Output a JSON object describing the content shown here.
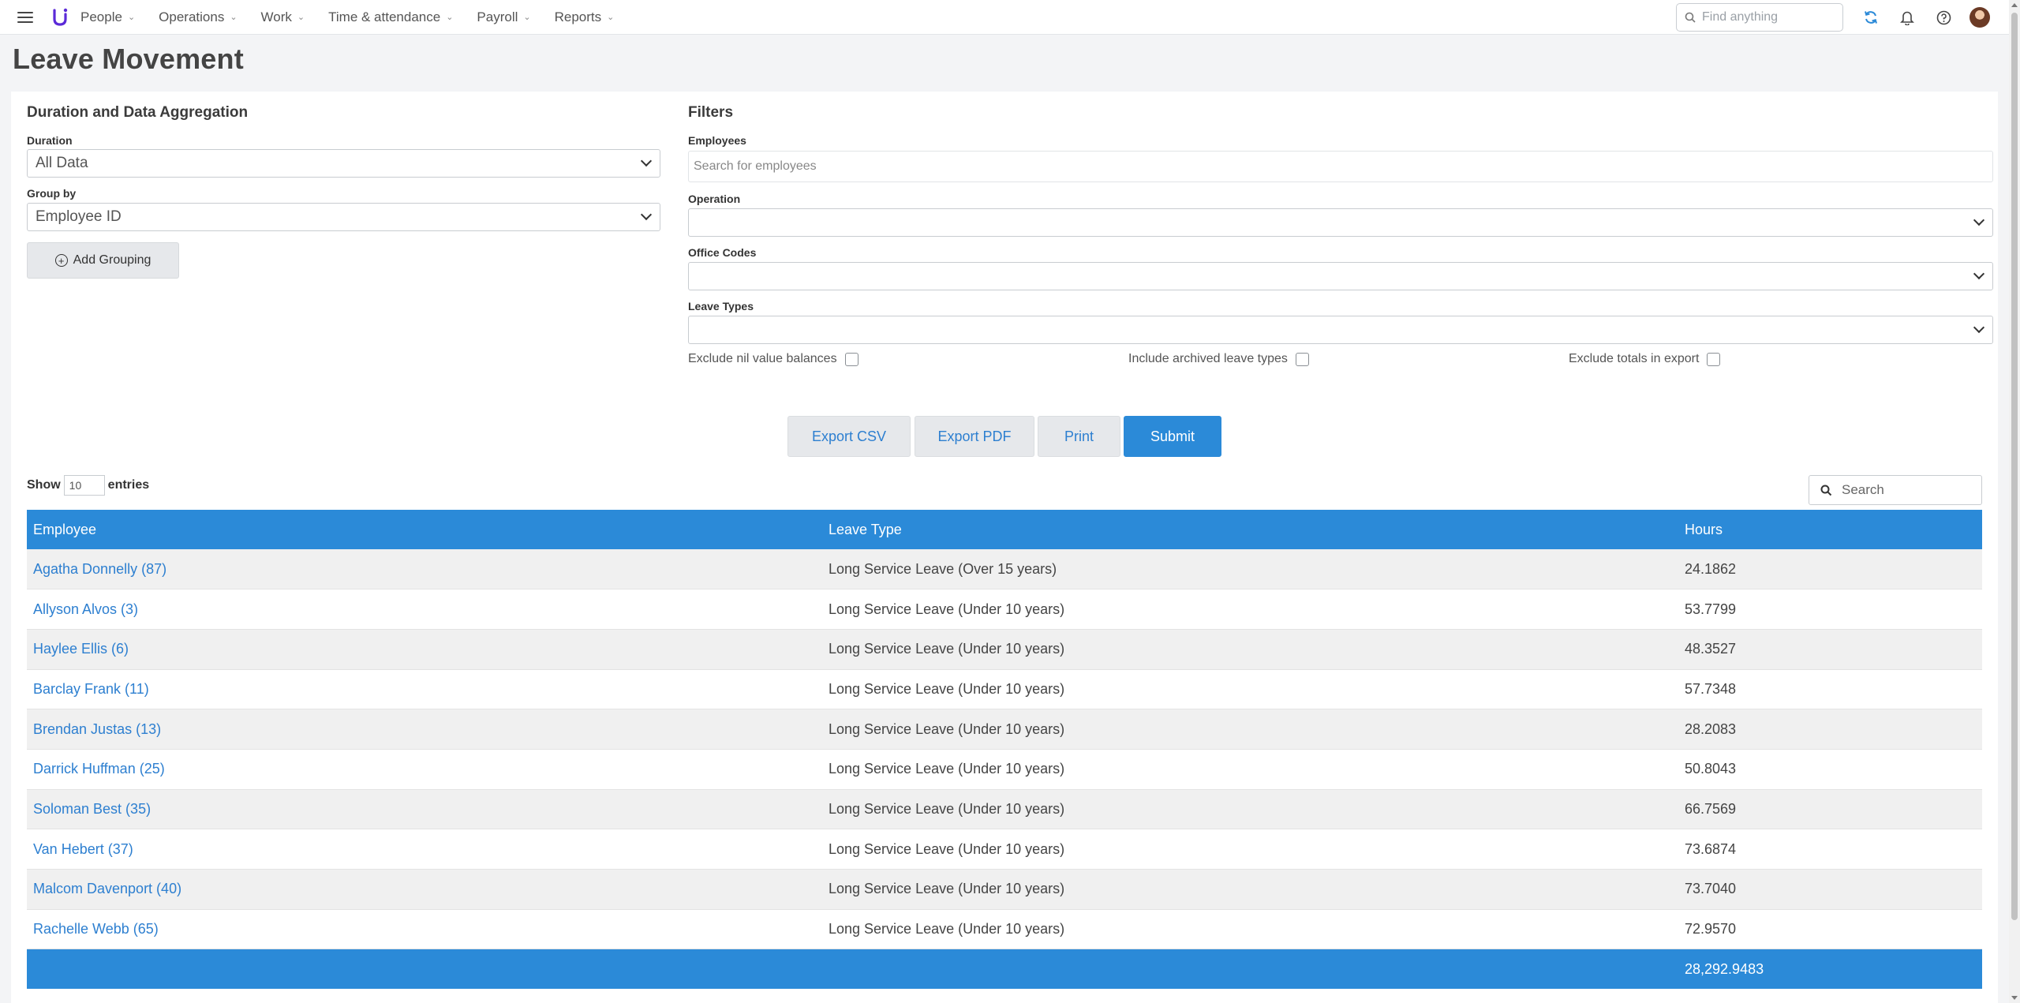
{
  "nav": {
    "items": [
      {
        "label": "People"
      },
      {
        "label": "Operations"
      },
      {
        "label": "Work"
      },
      {
        "label": "Time & attendance"
      },
      {
        "label": "Payroll"
      },
      {
        "label": "Reports"
      }
    ],
    "search_placeholder": "Find anything"
  },
  "page": {
    "title": "Leave Movement"
  },
  "aggregation": {
    "title": "Duration and Data Aggregation",
    "duration_label": "Duration",
    "duration_value": "All Data",
    "group_by_label": "Group by",
    "group_by_value": "Employee ID",
    "add_grouping_label": "Add Grouping"
  },
  "filters": {
    "title": "Filters",
    "employees_label": "Employees",
    "employees_placeholder": "Search for employees",
    "operation_label": "Operation",
    "office_codes_label": "Office Codes",
    "leave_types_label": "Leave Types",
    "checkboxes": [
      {
        "label": "Exclude nil value balances"
      },
      {
        "label": "Include archived leave types"
      },
      {
        "label": "Exclude totals in export"
      }
    ]
  },
  "actions": {
    "export_csv": "Export CSV",
    "export_pdf": "Export PDF",
    "print": "Print",
    "submit": "Submit"
  },
  "table": {
    "show_label": "Show",
    "show_value": "10",
    "entries_label": "entries",
    "search_placeholder": "Search",
    "columns": [
      "Employee",
      "Leave Type",
      "Hours"
    ],
    "rows": [
      {
        "employee": "Agatha Donnelly (87)",
        "leave_type": "Long Service Leave (Over 15 years)",
        "hours": "24.1862"
      },
      {
        "employee": "Allyson Alvos (3)",
        "leave_type": "Long Service Leave (Under 10 years)",
        "hours": "53.7799"
      },
      {
        "employee": "Haylee Ellis (6)",
        "leave_type": "Long Service Leave (Under 10 years)",
        "hours": "48.3527"
      },
      {
        "employee": "Barclay Frank (11)",
        "leave_type": "Long Service Leave (Under 10 years)",
        "hours": "57.7348"
      },
      {
        "employee": "Brendan Justas (13)",
        "leave_type": "Long Service Leave (Under 10 years)",
        "hours": "28.2083"
      },
      {
        "employee": "Darrick Huffman (25)",
        "leave_type": "Long Service Leave (Under 10 years)",
        "hours": "50.8043"
      },
      {
        "employee": "Soloman Best (35)",
        "leave_type": "Long Service Leave (Under 10 years)",
        "hours": "66.7569"
      },
      {
        "employee": "Van Hebert (37)",
        "leave_type": "Long Service Leave (Under 10 years)",
        "hours": "73.6874"
      },
      {
        "employee": "Malcom Davenport (40)",
        "leave_type": "Long Service Leave (Under 10 years)",
        "hours": "73.7040"
      },
      {
        "employee": "Rachelle Webb (65)",
        "leave_type": "Long Service Leave (Under 10 years)",
        "hours": "72.9570"
      }
    ],
    "total_hours": "28,292.9483"
  },
  "colors": {
    "accent": "#2b8ad8",
    "link": "#2d7fd0",
    "logo": "#5b2ad8"
  }
}
